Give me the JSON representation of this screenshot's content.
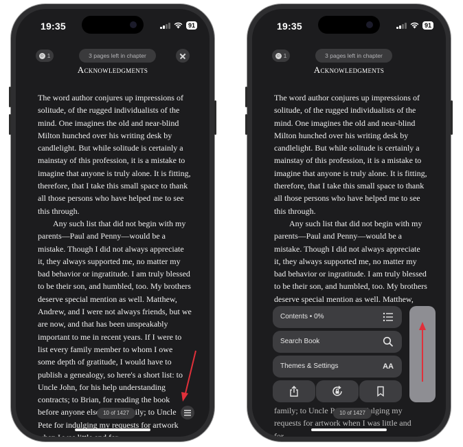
{
  "status_bar": {
    "time": "19:35",
    "battery": "91"
  },
  "header": {
    "badge_count": "1",
    "badge_icon": "emoji-icon",
    "pages_left": "3 pages left in chapter",
    "close_icon": "close-icon"
  },
  "chapter_title": "Acknowledgments",
  "left_body": [
    "The word author conjures up impressions of solitude, of the rugged individualists of the mind. One imagines the old and near-blind Milton hunched over his writing desk by candlelight. But while solitude is certainly a mainstay of this profession, it is a mistake to imagine that anyone is truly alone. It is fitting, therefore, that I take this small space to thank all those persons who have helped me to see this through.",
    "Any such list that did not begin with my parents—Paul and Penny—would be a mistake. Though I did not always appreciate it, they always supported me, no matter my bad behavior or ingratitude. I am truly blessed to be their son, and humbled, too. My brothers deserve special mention as well. Matthew, Andrew, and I were not always friends, but we are now, and that has been unspeakably important to me in recent years. If I were to list every family member to whom I owe some depth of gratitude, I would have to publish a genealogy, so here's a short list: to Uncle John, for his help understanding contracts; to Brian, for reading the book before anyone else in the family; to Uncle Pete for indulging my requests for artwork when I was little and for"
  ],
  "right_body": [
    "The word author conjures up impressions of solitude, of the rugged individualists of the mind. One imagines the old and near-blind Milton hunched over his writing desk by candlelight. But while solitude is certainly a mainstay of this profession, it is a mistake to imagine that anyone is truly alone. It is fitting, therefore, that I take this small space to thank all those persons who have helped me to see this through.",
    "Any such list that did not begin with my parents—Paul and Penny—would be a mistake. Though I did not always appreciate it, they always supported me, no matter my bad behavior or ingratitude. I am truly blessed to be their son, and humbled, too. My brothers deserve special mention as well. Matthew,"
  ],
  "right_body_tail": "family; to Uncle Pete for indulging my requests for artwork when I was little and for",
  "page_indicator": "10 of 1427",
  "menu": {
    "contents": "Contents • 0%",
    "search": "Search Book",
    "themes": "Themes & Settings",
    "themes_icon_text": "AA",
    "bottom_icons": [
      "share-icon",
      "rotation-lock-icon",
      "bookmark-icon"
    ]
  },
  "colors": {
    "screen_bg": "#1c1c1e",
    "annotation_arrow": "#e0303a",
    "menu_bg": "#3d3d40"
  }
}
